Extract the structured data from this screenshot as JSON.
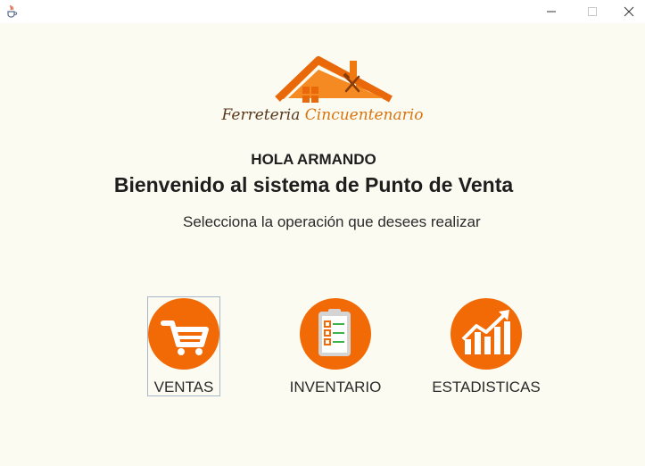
{
  "window": {
    "icon": "java-cup-icon",
    "controls": [
      "minimize-icon",
      "maximize-icon",
      "close-icon"
    ]
  },
  "brand": {
    "name_part1": "Ferreteria",
    "name_part2": "Cincuentenario",
    "colors": {
      "accent": "#f26a05",
      "text_dark": "#5a3a1e"
    }
  },
  "greeting": "HOLA ARMANDO",
  "welcome": "Bienvenido al sistema de Punto de Venta",
  "instruction": "Selecciona la operación que desees realizar",
  "menu": {
    "items": [
      {
        "label": "VENTAS",
        "icon": "shopping-cart-icon",
        "selected": true
      },
      {
        "label": "INVENTARIO",
        "icon": "clipboard-checklist-icon",
        "selected": false
      },
      {
        "label": "ESTADISTICAS",
        "icon": "bar-chart-growth-icon",
        "selected": false
      }
    ]
  }
}
